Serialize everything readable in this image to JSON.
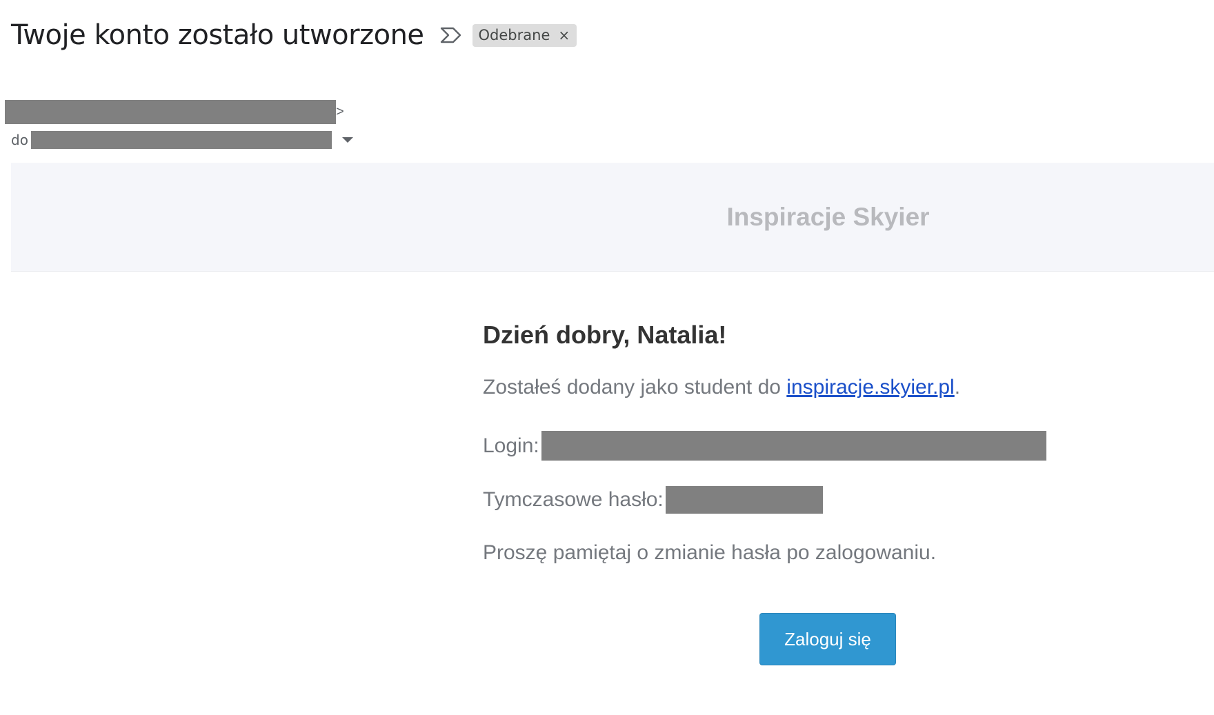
{
  "header": {
    "subject": "Twoje konto zostało utworzone",
    "importance_icon": "importance-marker-icon",
    "label": "Odebrane",
    "label_remove_glyph": "×"
  },
  "sender": {
    "suffix": ">",
    "to_prefix": "do",
    "details_icon": "caret-down-icon"
  },
  "email": {
    "brand": "Inspiracje Skyier",
    "greeting": "Dzień dobry, Natalia!",
    "intro_text": "Zostałeś dodany jako student do ",
    "intro_link": "inspiracje.skyier.pl",
    "intro_end": ".",
    "login_label": "Login:",
    "password_label": "Tymczasowe hasło:",
    "note": "Proszę pamiętaj o zmianie hasła po zalogowaniu.",
    "button_label": "Zaloguj się"
  },
  "colors": {
    "button": "#3097d1",
    "link": "#1a4fc9",
    "banner": "#f5f6fa",
    "redaction": "#808080"
  }
}
